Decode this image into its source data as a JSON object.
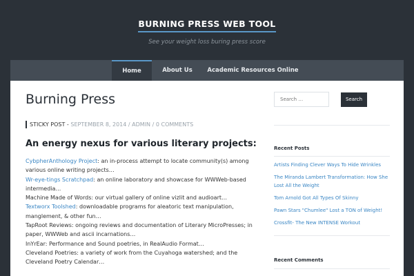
{
  "header": {
    "site_title": "BURNING PRESS WEB TOOL",
    "tagline": "See your weight loss buring press score"
  },
  "nav": {
    "items": [
      {
        "label": "Home",
        "active": true
      },
      {
        "label": "About Us",
        "active": false
      },
      {
        "label": "Academic Resources Online",
        "active": false
      }
    ]
  },
  "post": {
    "title": "Burning Press",
    "meta": {
      "sticky": "STICKY POST -",
      "date": "SEPTEMBER 8, 2014",
      "sep1": "/",
      "author": "ADMIN",
      "sep2": "/",
      "comments": "0 COMMENTS"
    },
    "heading": "An energy nexus for various literary projects:",
    "entries": [
      {
        "link": "CybpherAnthology Project",
        "text": ": an in-process attempt to locate community(s) among various online writing projects…"
      },
      {
        "link": "Wr-eye-tings Scratchpad",
        "text": ": an online laboratory and showcase for WWWeb-based intermedia…"
      },
      {
        "link": "",
        "text": "Machine Made of Words: our virtual gallery of online vizlit and audioart…"
      },
      {
        "link": "Textworx Toolshed",
        "text": ": downloadable programs for aleatoric text manipulation, manglement, & other fun…"
      },
      {
        "link": "",
        "text": "TapRoot Reviews: ongoing reviews and documentation of Literary MicroPresses; in paper, WWWeb and ascii incarnations…"
      },
      {
        "link": "",
        "text": "InYrEar: Performance and Sound poetries, in RealAudio Format…"
      },
      {
        "link": "",
        "text": "Cleveland Poetries: a variety of work from the Cuyahoga watershed; and the Cleveland Poetry Calendar…"
      }
    ]
  },
  "sidebar": {
    "search": {
      "placeholder": "Search …",
      "button_label": "Search"
    },
    "recent_posts": {
      "title": "Recent Posts",
      "items": [
        "Artists Finding Clever Ways To Hide Wrinkles",
        "The Miranda Lambert Transformation: How She Lost All the Weight",
        "Tom Arnold Got All Types Of Skinny",
        "Pawn Stars \"Chumlee\" Lost a TON of Weight!",
        "Crossfit- The New INTENSE Workout"
      ]
    },
    "recent_comments": {
      "title": "Recent Comments"
    }
  },
  "colors": {
    "accent": "#5a98c8",
    "link": "#3a86c4",
    "dark_bg": "#2b3138",
    "nav_bg": "#444c55"
  }
}
